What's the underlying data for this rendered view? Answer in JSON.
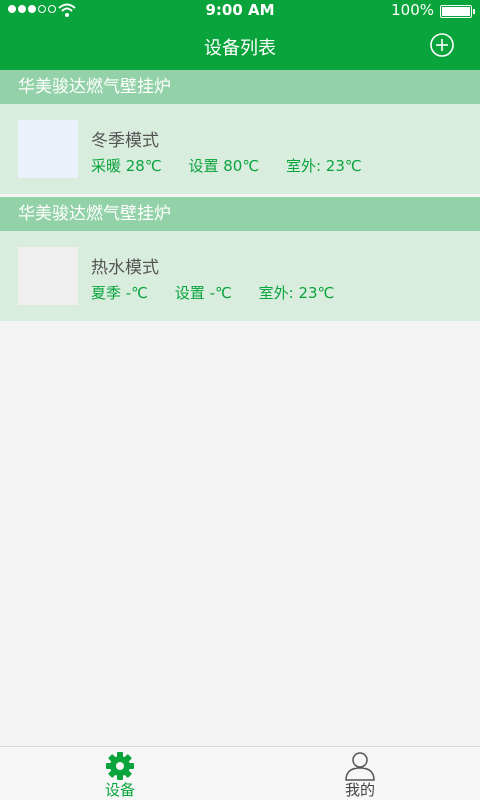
{
  "status_bar": {
    "time": "9:00 AM",
    "battery": "100%"
  },
  "header": {
    "title": "设备列表"
  },
  "devices": [
    {
      "group_name": "华美骏达燃气壁挂炉",
      "mode": "冬季模式",
      "stat1": "采暖 28℃",
      "stat2": "设置 80℃",
      "stat3": "室外: 23℃",
      "thumb_color": "#eaf1fa"
    },
    {
      "group_name": "华美骏达燃气壁挂炉",
      "mode": "热水模式",
      "stat1": "夏季 -℃",
      "stat2": "设置 -℃",
      "stat3": "室外: 23℃",
      "thumb_color": "#efefef"
    }
  ],
  "tabs": [
    {
      "label": "设备",
      "icon": "gear-icon"
    },
    {
      "label": "我的",
      "icon": "user-icon"
    }
  ],
  "colors": {
    "accent": "#0aa43c",
    "group_header": "#93d2a8",
    "row_bg": "#d9eddf",
    "page_bg": "#f4f4f4"
  }
}
